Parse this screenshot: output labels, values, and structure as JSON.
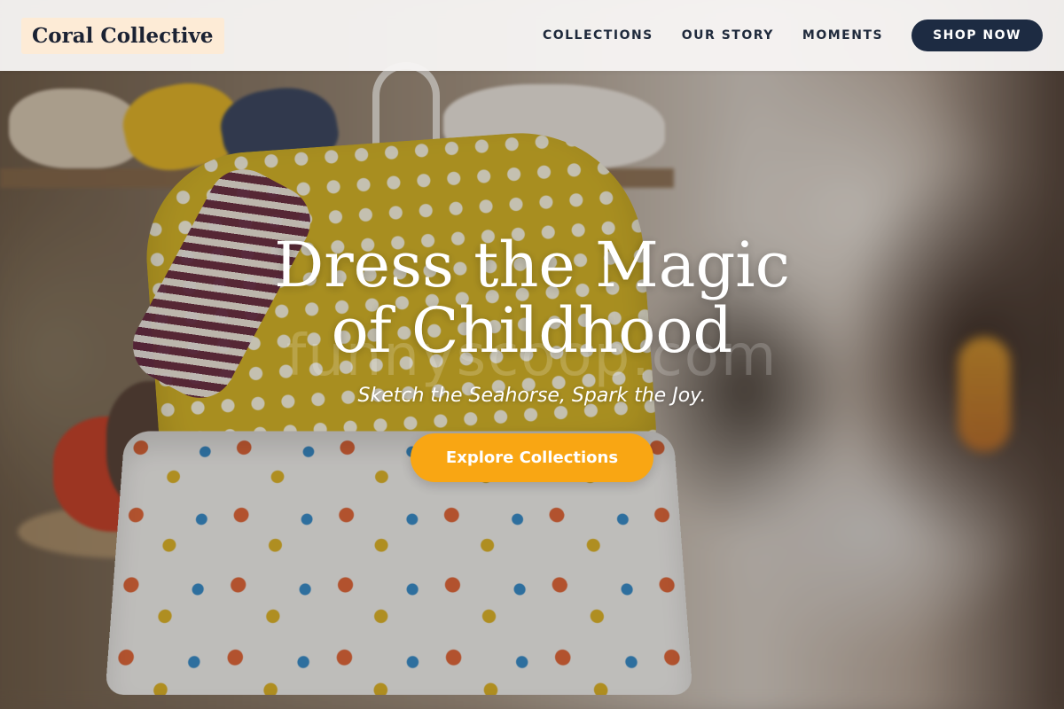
{
  "brand": {
    "name": "Coral Collective"
  },
  "nav": {
    "links": [
      {
        "label": "COLLECTIONS"
      },
      {
        "label": "OUR STORY"
      },
      {
        "label": "MOMENTS"
      }
    ],
    "cta_label": "SHOP NOW"
  },
  "hero": {
    "title": "Dress the Magic of Childhood",
    "tagline": "Sketch the Seahorse, Spark the Joy.",
    "cta_label": "Explore Collections",
    "watermark": "funnyscoop.com"
  },
  "colors": {
    "primary_navy": "#1d2b42",
    "accent_orange": "#f9a613",
    "logo_bg": "#fdebd6"
  }
}
